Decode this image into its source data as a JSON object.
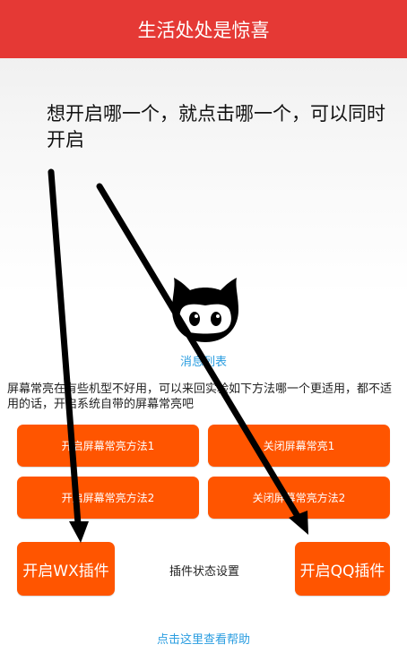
{
  "header": {
    "title": "生活处处是惊喜"
  },
  "hint_text": "想开启哪一个，就点击哪一个，可以同时开启",
  "message_list_link": "消息列表",
  "description": "屏幕常亮在有些机型不好用，可以来回实验如下方法哪一个更适用，都不适用的话，开启系统自带的屏幕常亮吧",
  "buttons": {
    "screen_on_1": "开启屏幕常亮方法1",
    "screen_off_1": "关闭屏幕常亮1",
    "screen_on_2": "开启屏幕常亮方法2",
    "screen_off_2": "关闭屏幕常亮方法2",
    "wx_plugin": "开启WX插件",
    "qq_plugin": "开启QQ插件"
  },
  "plugin_status_label": "插件状态设置",
  "help_link": "点击这里查看帮助",
  "colors": {
    "title_bar": "#e53935",
    "button": "#ff5500",
    "link": "#2a9de0"
  }
}
